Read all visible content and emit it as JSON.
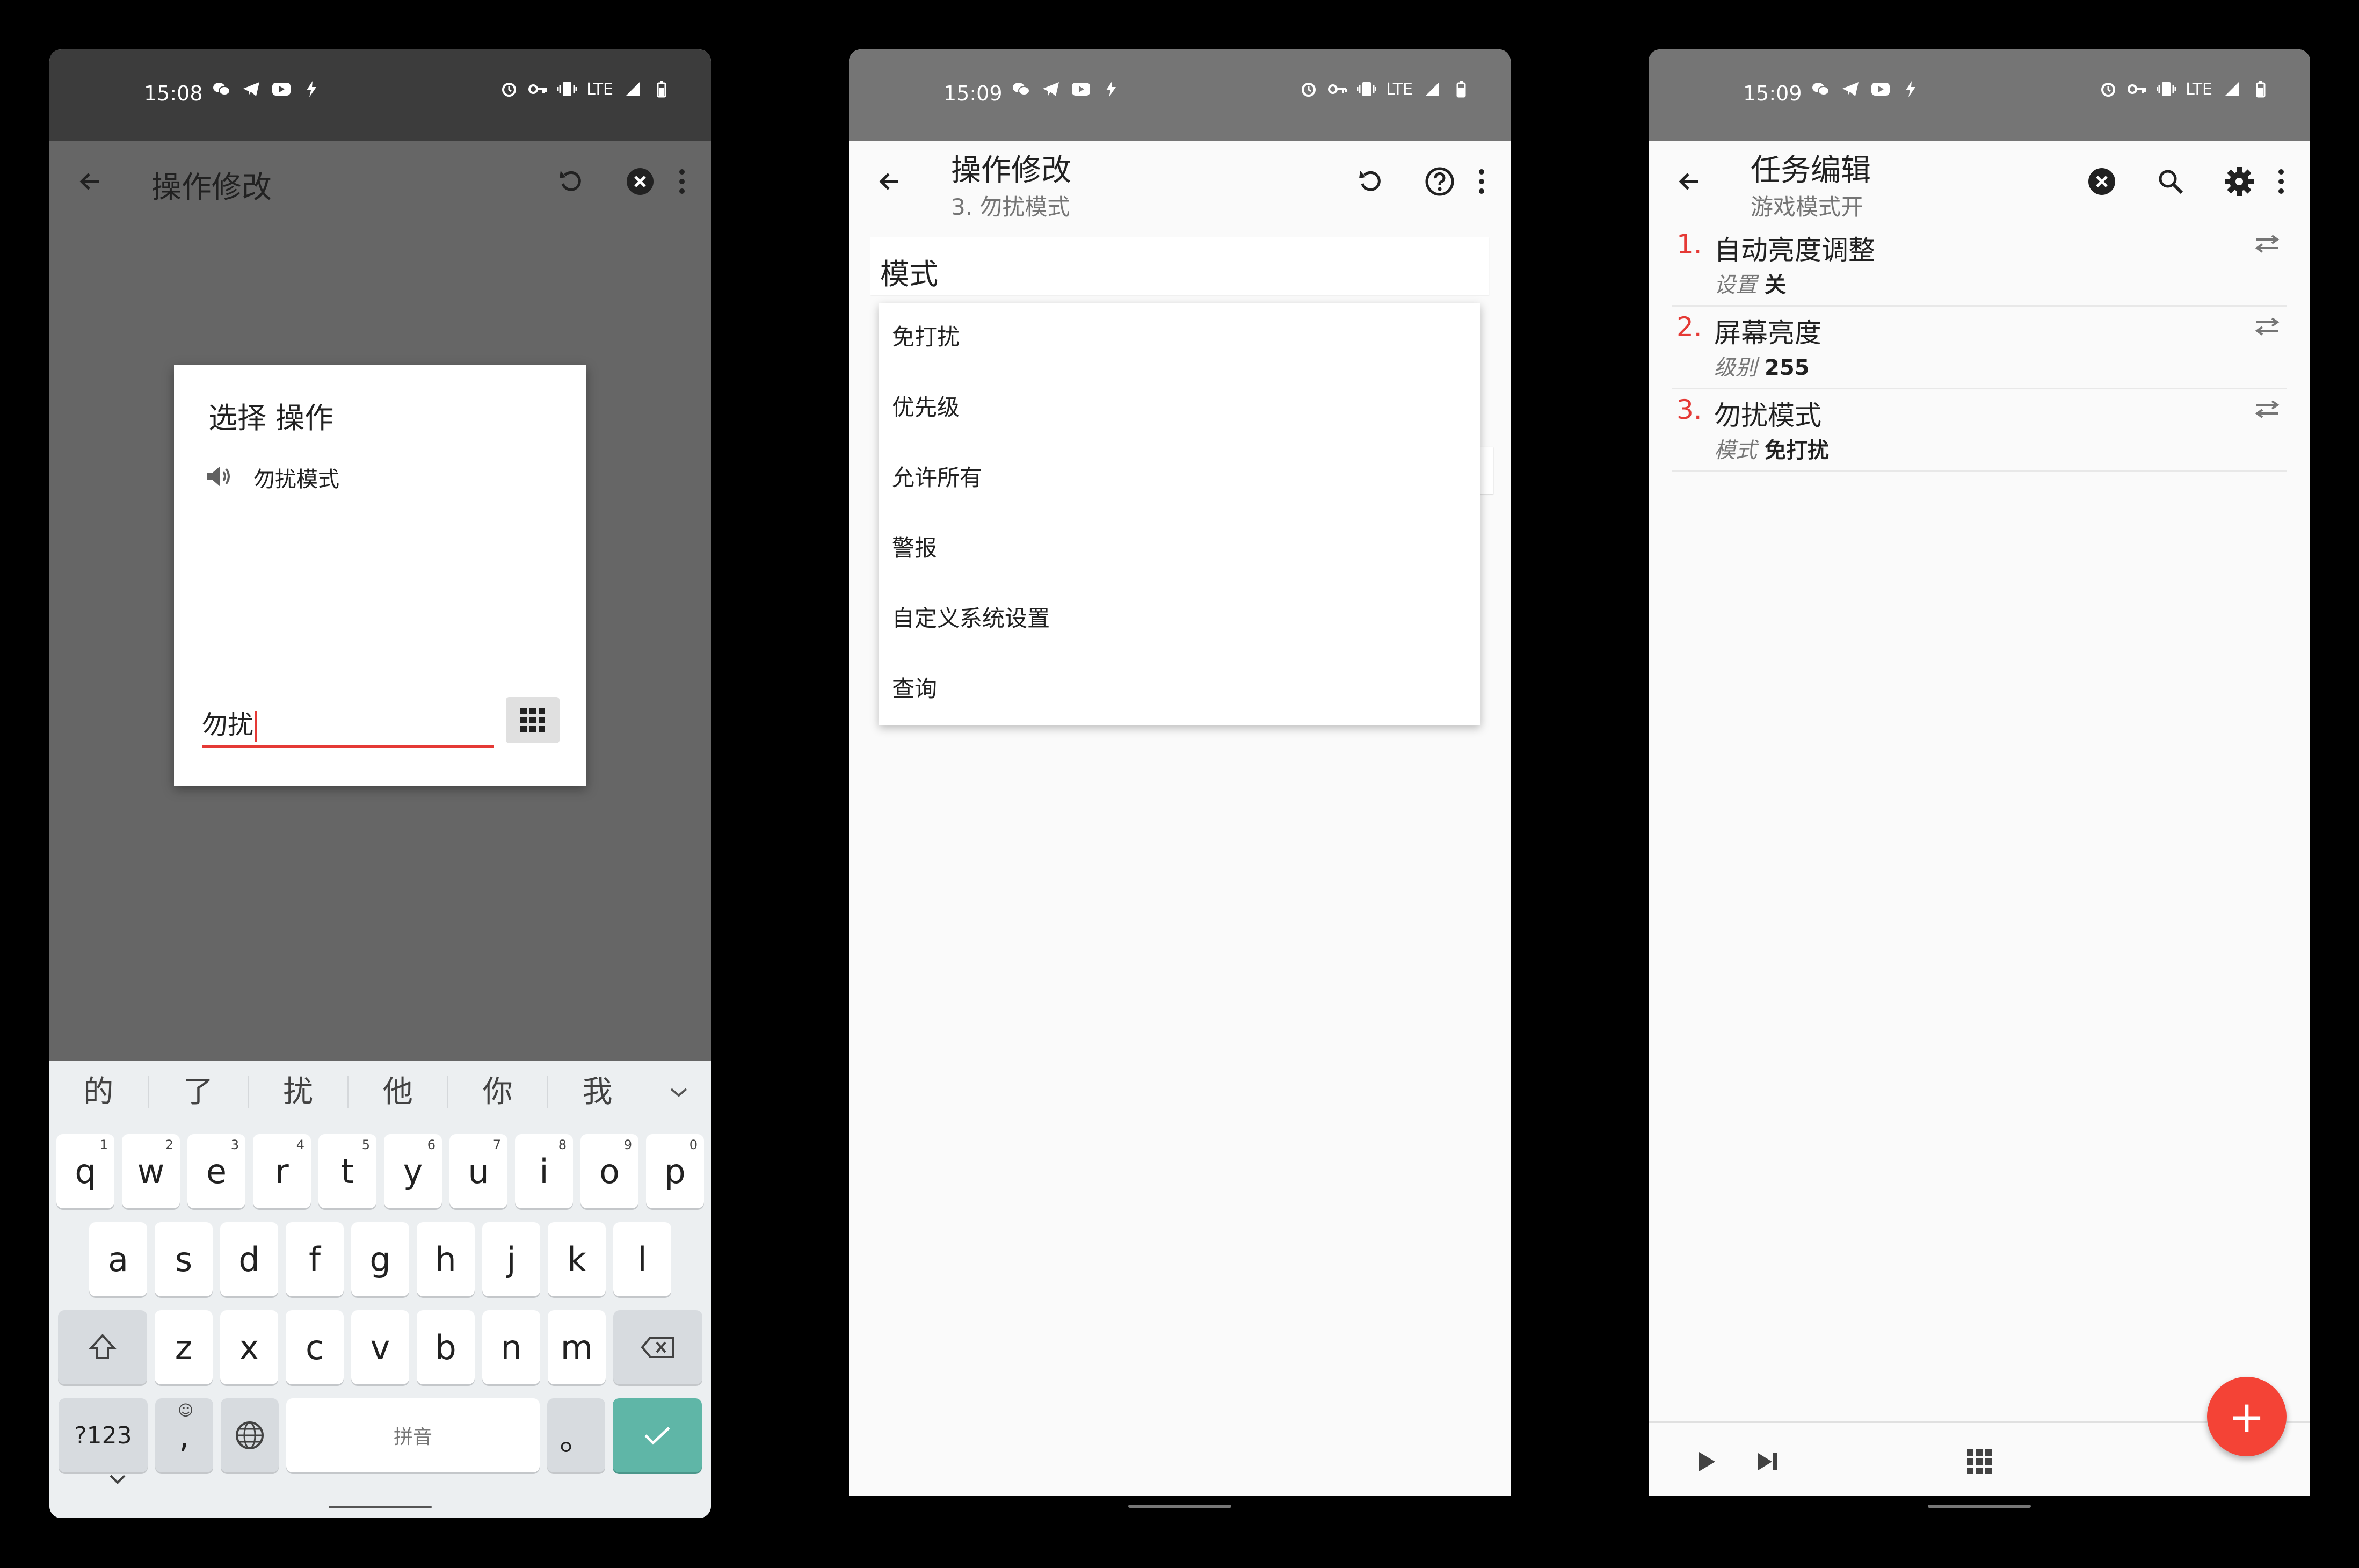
{
  "phone1": {
    "status": {
      "time": "15:08",
      "network": "LTE"
    },
    "appbar": {
      "title": "操作修改"
    },
    "dialog": {
      "title": "选择 操作",
      "item_label": "勿扰模式",
      "input_value": "勿扰"
    },
    "keyboard": {
      "candidates": [
        "的",
        "了",
        "扰",
        "他",
        "你",
        "我"
      ],
      "row1": [
        {
          "k": "q",
          "n": "1"
        },
        {
          "k": "w",
          "n": "2"
        },
        {
          "k": "e",
          "n": "3"
        },
        {
          "k": "r",
          "n": "4"
        },
        {
          "k": "t",
          "n": "5"
        },
        {
          "k": "y",
          "n": "6"
        },
        {
          "k": "u",
          "n": "7"
        },
        {
          "k": "i",
          "n": "8"
        },
        {
          "k": "o",
          "n": "9"
        },
        {
          "k": "p",
          "n": "0"
        }
      ],
      "row2": [
        "a",
        "s",
        "d",
        "f",
        "g",
        "h",
        "j",
        "k",
        "l"
      ],
      "row3": [
        "z",
        "x",
        "c",
        "v",
        "b",
        "n",
        "m"
      ],
      "symbols_key": "?123",
      "comma_key": ",",
      "emoji_hint": "☺",
      "space_label": "拼音",
      "period_key": "。"
    }
  },
  "phone2": {
    "status": {
      "time": "15:09",
      "network": "LTE"
    },
    "appbar": {
      "title": "操作修改",
      "subtitle": "3. 勿扰模式"
    },
    "field_label": "模式",
    "dropdown_options": [
      "免打扰",
      "优先级",
      "允许所有",
      "警报",
      "自定义系统设置",
      "查询"
    ]
  },
  "phone3": {
    "status": {
      "time": "15:09",
      "network": "LTE"
    },
    "appbar": {
      "title": "任务编辑",
      "subtitle": "游戏模式开"
    },
    "tasks": [
      {
        "num": "1.",
        "name": "自动亮度调整",
        "param_label": "设置",
        "param_value": "关"
      },
      {
        "num": "2.",
        "name": "屏幕亮度",
        "param_label": "级别",
        "param_value": "255"
      },
      {
        "num": "3.",
        "name": "勿扰模式",
        "param_label": "模式",
        "param_value": "免打扰"
      }
    ],
    "fab_label": "+"
  },
  "colors": {
    "accent": "#e53935",
    "fab": "#f44336",
    "enter_key": "#5fb6a7",
    "dim": "#666666",
    "statusbar_dark": "#3c3c3c",
    "statusbar_grey": "#757575"
  },
  "icons": [
    "back-arrow-icon",
    "undo-icon",
    "cancel-icon",
    "more-vert-icon",
    "help-icon",
    "search-icon",
    "settings-icon",
    "swap-icon",
    "play-icon",
    "skip-next-icon",
    "grid-icon",
    "speaker-icon",
    "shift-icon",
    "backspace-icon",
    "globe-icon",
    "check-icon",
    "chevron-down-icon"
  ]
}
